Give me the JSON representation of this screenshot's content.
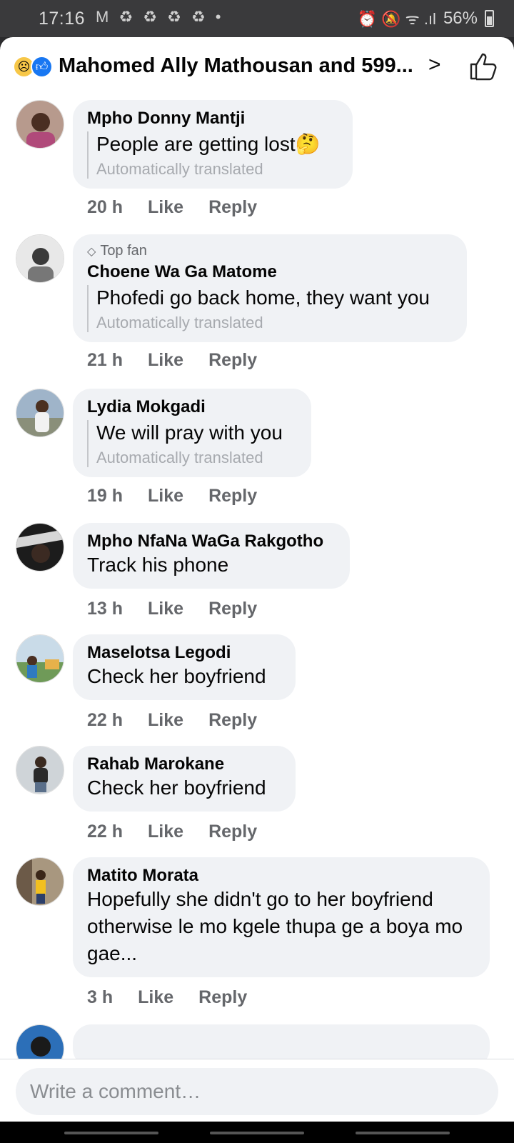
{
  "status_bar": {
    "time": "17:16",
    "notif_icons": "M ♻ ♻ ♻ ♻ •",
    "right_icons": "⏰ 🔕 ᯤ .ıl",
    "battery": "56%"
  },
  "header": {
    "title": "Mahomed Ally Mathousan and 599...",
    "reaction_icons": [
      "sad-face-icon",
      "like-icon"
    ],
    "like_icon": "thumbs-up-outline-icon"
  },
  "comments": [
    {
      "author": "Mpho Donny Mantji",
      "text": "People are getting lost🤔",
      "translated": true,
      "translated_label": "Automatically translated",
      "top_fan": false,
      "time": "20 h",
      "like": "Like",
      "reply": "Reply"
    },
    {
      "author": "Choene Wa Ga Matome",
      "text": "Phofedi go back home, they want you",
      "translated": true,
      "translated_label": "Automatically translated",
      "top_fan": true,
      "top_fan_label": "Top fan",
      "time": "21 h",
      "like": "Like",
      "reply": "Reply"
    },
    {
      "author": "Lydia Mokgadi",
      "text": "We will pray with you",
      "translated": true,
      "translated_label": "Automatically translated",
      "top_fan": false,
      "time": "19 h",
      "like": "Like",
      "reply": "Reply"
    },
    {
      "author": "Mpho NfaNa WaGa Rakgotho",
      "text": "Track his phone",
      "translated": false,
      "top_fan": false,
      "time": "13 h",
      "like": "Like",
      "reply": "Reply"
    },
    {
      "author": "Maselotsa Legodi",
      "text": "Check her boyfriend",
      "translated": false,
      "top_fan": false,
      "time": "22 h",
      "like": "Like",
      "reply": "Reply"
    },
    {
      "author": "Rahab Marokane",
      "text": "Check her boyfriend",
      "translated": false,
      "top_fan": false,
      "time": "22 h",
      "like": "Like",
      "reply": "Reply"
    },
    {
      "author": "Matito Morata",
      "text": "Hopefully she didn't go to her boyfriend otherwise le mo kgele thupa ge a boya mo gae...",
      "translated": false,
      "top_fan": false,
      "time": "3 h",
      "like": "Like",
      "reply": "Reply"
    }
  ],
  "composer": {
    "placeholder": "Write a comment…"
  }
}
